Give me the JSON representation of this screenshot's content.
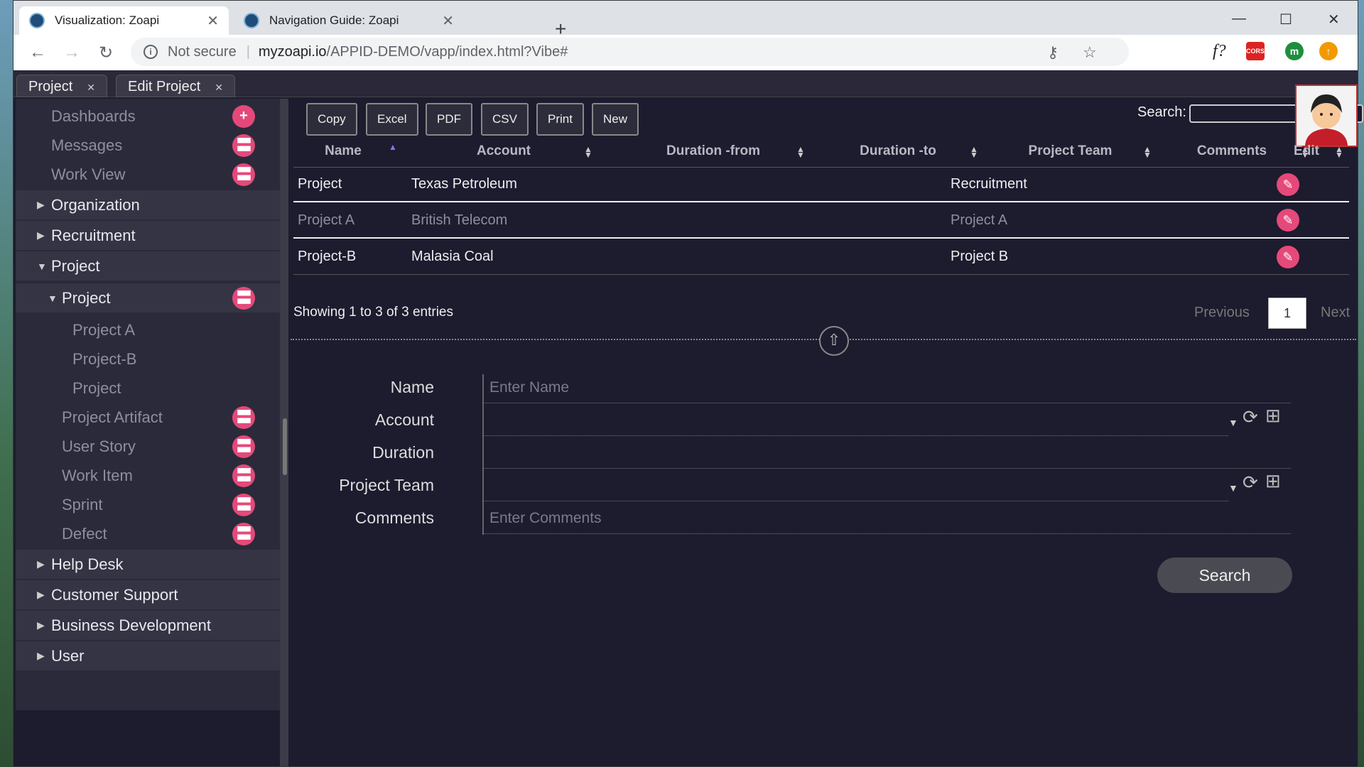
{
  "browser": {
    "tabs": [
      {
        "title": "Visualization: Zoapi",
        "active": true
      },
      {
        "title": "Navigation Guide: Zoapi",
        "active": false
      }
    ],
    "new_tab_label": "+",
    "omnibox": {
      "security": "Not secure",
      "host": "myzoapi.io",
      "path": "/APPID-DEMO/vapp/index.html?Vibe#"
    },
    "extensions": {
      "f_label": "f?",
      "cors_label": "CORS",
      "profile_initial": "m"
    }
  },
  "app_tabs": [
    {
      "label": "Project"
    },
    {
      "label": "Edit Project"
    }
  ],
  "sidebar": {
    "items": [
      {
        "label": "Dashboards"
      },
      {
        "label": "Messages"
      },
      {
        "label": "Work View"
      },
      {
        "label": "Organization"
      },
      {
        "label": "Recruitment"
      },
      {
        "label": "Project"
      },
      {
        "label": "Project"
      },
      {
        "label": "Project A"
      },
      {
        "label": "Project-B"
      },
      {
        "label": "Project"
      },
      {
        "label": "Project Artifact"
      },
      {
        "label": "User Story"
      },
      {
        "label": "Work Item"
      },
      {
        "label": "Sprint"
      },
      {
        "label": "Defect"
      },
      {
        "label": "Help Desk"
      },
      {
        "label": "Customer Support"
      },
      {
        "label": "Business Development"
      },
      {
        "label": "User"
      }
    ]
  },
  "table": {
    "buttons": [
      "Copy",
      "Excel",
      "PDF",
      "CSV",
      "Print",
      "New"
    ],
    "search_label": "Search:",
    "columns": [
      "Name",
      "Account",
      "Duration -from",
      "Duration -to",
      "Project Team",
      "Comments",
      "Edit"
    ],
    "rows": [
      {
        "name": "Project",
        "account": "Texas Petroleum",
        "from": "",
        "to": "",
        "team": "Recruitment",
        "comments": ""
      },
      {
        "name": "Project A",
        "account": "British Telecom",
        "from": "",
        "to": "",
        "team": "Project A",
        "comments": ""
      },
      {
        "name": "Project-B",
        "account": "Malasia Coal",
        "from": "",
        "to": "",
        "team": "Project B",
        "comments": ""
      }
    ],
    "info": "Showing 1 to 3 of 3 entries",
    "pagination": {
      "previous": "Previous",
      "page": "1",
      "next": "Next"
    }
  },
  "form": {
    "fields": [
      {
        "label": "Name",
        "placeholder": "Enter Name"
      },
      {
        "label": "Account",
        "placeholder": ""
      },
      {
        "label": "Duration",
        "placeholder": ""
      },
      {
        "label": "Project Team",
        "placeholder": ""
      },
      {
        "label": "Comments",
        "placeholder": "Enter Comments"
      }
    ],
    "search_button": "Search"
  },
  "colors": {
    "accent": "#e4497a",
    "background": "#1d1b2e",
    "sidebar": "#2b2a3a"
  }
}
